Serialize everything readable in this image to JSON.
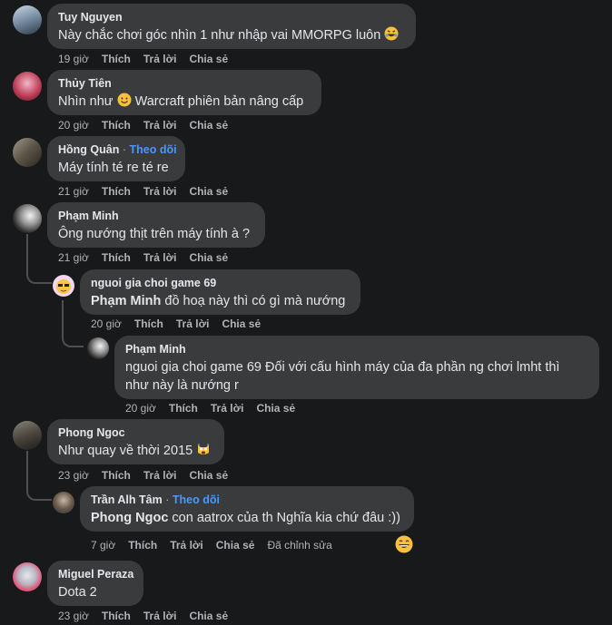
{
  "comments": [
    {
      "name": "Tuy Nguyen",
      "text": "Này chắc chơi góc nhìn 1 như nhập vai MMORPG luôn",
      "emoji": "rofl",
      "time": "19 giờ",
      "like": "Thích",
      "reply": "Trả lời",
      "share": "Chia sẻ"
    },
    {
      "name": "Thủy Tiên",
      "text_before": "Nhìn như",
      "text_after": "Warcraft phiên bản nâng cấp",
      "emoji": "smile",
      "time": "20 giờ",
      "like": "Thích",
      "reply": "Trả lời",
      "share": "Chia sẻ"
    },
    {
      "name": "Hồng Quân",
      "follow": "Theo dõi",
      "text": "Máy tính té re té re",
      "time": "21 giờ",
      "like": "Thích",
      "reply": "Trả lời",
      "share": "Chia sẻ"
    },
    {
      "name": "Phạm Minh",
      "text": "Ông nướng thịt trên máy tính à ?",
      "time": "21 giờ",
      "like": "Thích",
      "reply": "Trả lời",
      "share": "Chia sẻ"
    },
    {
      "name": "nguoi gia choi game 69",
      "mention": "Phạm Minh",
      "text": "đồ hoạ này thì có gì mà nướng",
      "time": "20 giờ",
      "like": "Thích",
      "reply": "Trả lời",
      "share": "Chia sẻ"
    },
    {
      "name": "Phạm Minh",
      "text_line1": "nguoi gia choi game 69 Đối với cấu hình máy của đa phần ng chơi lmht thì",
      "text_line2": "như này là nướng r",
      "time": "20 giờ",
      "like": "Thích",
      "reply": "Trả lời",
      "share": "Chia sẻ"
    },
    {
      "name": "Phong Ngoc",
      "text": "Như quay về thời 2015",
      "emoji": "cat",
      "time": "23 giờ",
      "like": "Thích",
      "reply": "Trả lời",
      "share": "Chia sẻ"
    },
    {
      "name": "Trần Alh Tâm",
      "follow": "Theo dõi",
      "mention": "Phong Ngoc",
      "text": "con aatrox của th Nghĩa kia chứ đâu :))",
      "time": "7 giờ",
      "like": "Thích",
      "reply": "Trả lời",
      "share": "Chia sẻ",
      "edited": "Đã chỉnh sửa",
      "reaction": "grin"
    },
    {
      "name": "Miguel Peraza",
      "text": "Dota 2",
      "time": "23 giờ",
      "like": "Thích",
      "reply": "Trả lời",
      "share": "Chia sẻ"
    }
  ],
  "colors": {
    "background": "#18191a",
    "bubble": "#3a3b3c",
    "follow": "#4599ff",
    "meta": "#b0b3b8"
  }
}
